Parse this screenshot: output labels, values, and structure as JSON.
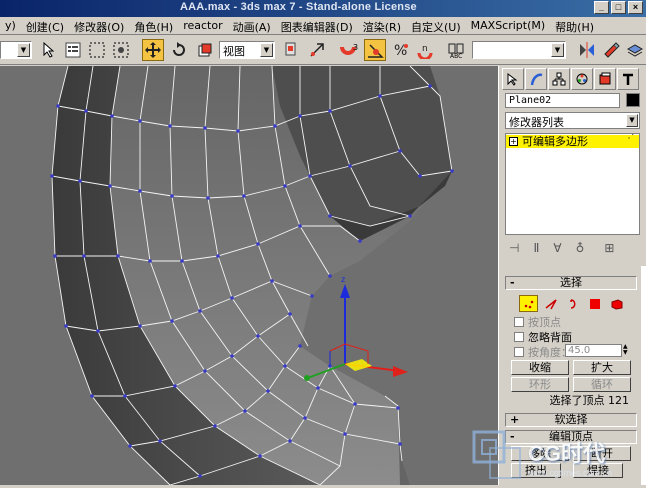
{
  "window": {
    "title": "AAA.max - 3ds max 7 - Stand-alone License",
    "controls": [
      "_",
      "□",
      "×"
    ]
  },
  "menu": {
    "items": [
      "y)",
      "创建(C)",
      "修改器(O)",
      "角色(H)",
      "reactor",
      "动画(A)",
      "图表编辑器(D)",
      "渲染(R)",
      "自定义(U)",
      "MAXScript(M)",
      "帮助(H)"
    ]
  },
  "toolbar": {
    "selection_filter_value": "",
    "reference_coord_value": "视图",
    "named_selection_value": "",
    "angle_snap_label": "3",
    "percent_snap_label": "%",
    "spinner_snap_label": "n"
  },
  "viewport": {
    "background": "#6f6f6f",
    "edge_color": "#ffffff",
    "vertex_color": "#3a3ac8",
    "gizmo": {
      "x_color": "#e0201a",
      "y_color": "#20a020",
      "z_color": "#1a2adc",
      "plane_color": "#fef200"
    }
  },
  "command_panel": {
    "tabs": [
      "create-icon",
      "modify-icon",
      "hierarchy-icon",
      "motion-icon",
      "display-icon",
      "utilities-icon"
    ],
    "object_name": "Plane02",
    "object_color": "#000000",
    "modifier_list_label": "修改器列表",
    "stack_item": "可编辑多边形",
    "selection_rollout": {
      "title": "选择",
      "sign": "-",
      "checks": [
        {
          "label": "按顶点",
          "disabled": true
        },
        {
          "label": "忽略背面",
          "disabled": false
        },
        {
          "label": "按角度：",
          "disabled": true
        }
      ],
      "angle_value": "45.0",
      "buttons": {
        "shrink": "收缩",
        "grow": "扩大",
        "ring": "环形",
        "loop": "循环"
      },
      "status": "选择了顶点 121"
    },
    "soft_selection_rollout": {
      "title": "软选择",
      "sign": "+"
    },
    "edit_vertices_rollout": {
      "title": "编辑顶点",
      "buttons": {
        "remove": "移除",
        "break": "断开",
        "extrude": "挤出",
        "weld": "焊接"
      }
    }
  },
  "watermark": {
    "text": "CG时代",
    "url": "www.cgtimes.com.cn"
  }
}
